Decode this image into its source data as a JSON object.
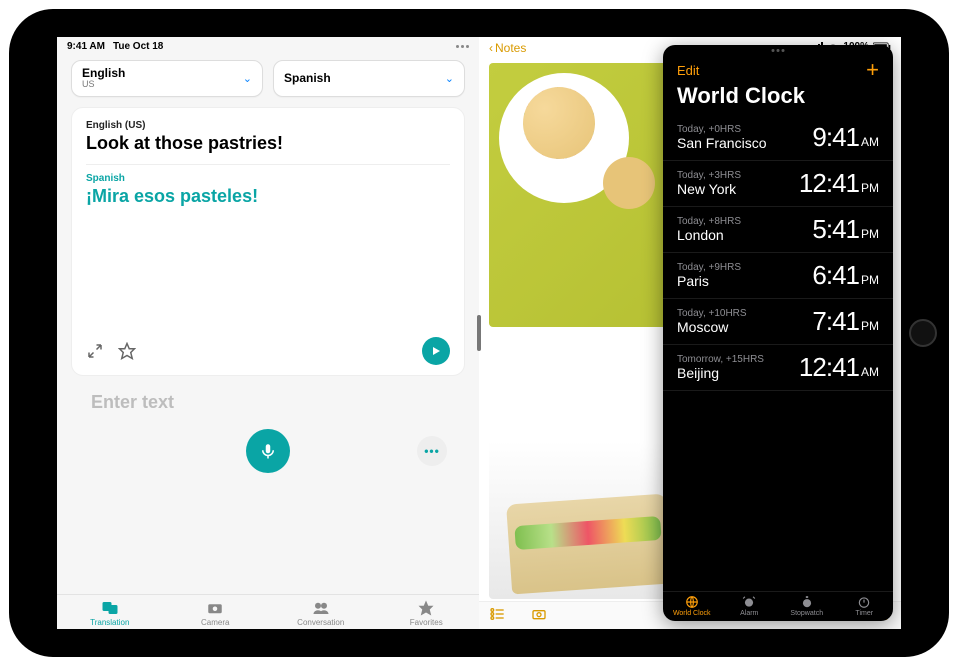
{
  "status": {
    "time": "9:41 AM",
    "date": "Tue Oct 18",
    "battery_pct": "100%"
  },
  "translate": {
    "source_lang": {
      "name": "English",
      "sub": "US"
    },
    "target_lang": {
      "name": "Spanish",
      "sub": ""
    },
    "src_label": "English (US)",
    "src_text": "Look at those pastries!",
    "tgt_label": "Spanish",
    "tgt_text": "¡Mira esos pasteles!",
    "placeholder": "Enter text",
    "tabs": {
      "translation": "Translation",
      "camera": "Camera",
      "conversation": "Conversation",
      "favorites": "Favorites"
    }
  },
  "notes": {
    "back_label": "Notes"
  },
  "clock": {
    "edit": "Edit",
    "add": "+",
    "title": "World Clock",
    "rows": [
      {
        "offset": "Today, +0HRS",
        "city": "San Francisco",
        "time": "9:41",
        "ampm": "AM"
      },
      {
        "offset": "Today, +3HRS",
        "city": "New York",
        "time": "12:41",
        "ampm": "PM"
      },
      {
        "offset": "Today, +8HRS",
        "city": "London",
        "time": "5:41",
        "ampm": "PM"
      },
      {
        "offset": "Today, +9HRS",
        "city": "Paris",
        "time": "6:41",
        "ampm": "PM"
      },
      {
        "offset": "Today, +10HRS",
        "city": "Moscow",
        "time": "7:41",
        "ampm": "PM"
      },
      {
        "offset": "Tomorrow, +15HRS",
        "city": "Beijing",
        "time": "12:41",
        "ampm": "AM"
      }
    ],
    "tabs": {
      "world_clock": "World Clock",
      "alarm": "Alarm",
      "stopwatch": "Stopwatch",
      "timer": "Timer"
    }
  }
}
